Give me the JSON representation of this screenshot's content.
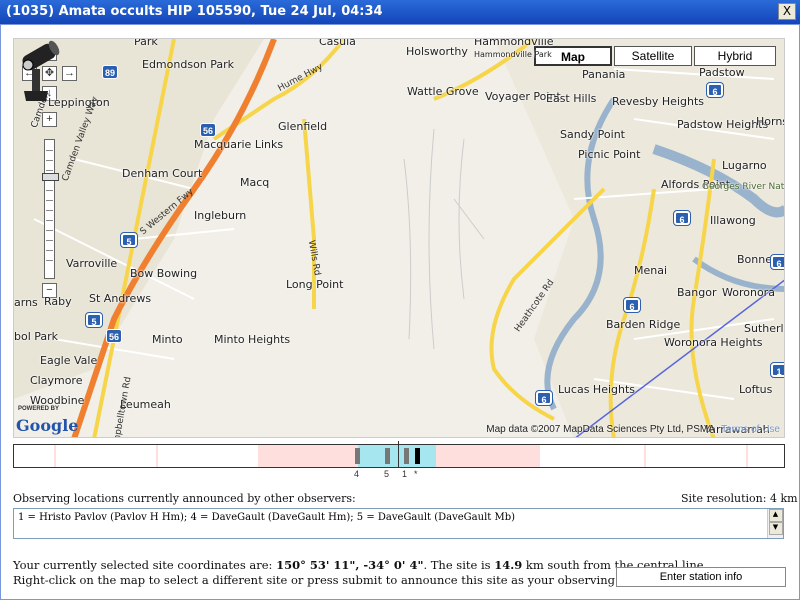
{
  "window": {
    "title": "(1035) Amata occults HIP 105590, Tue 24 Jul, 04:34",
    "close_glyph": "X"
  },
  "map": {
    "types": [
      {
        "label": "Map",
        "active": true
      },
      {
        "label": "Satellite",
        "active": false
      },
      {
        "label": "Hybrid",
        "active": false
      }
    ],
    "zoom_in": "+",
    "zoom_out": "−",
    "places": [
      "Park",
      "Casula",
      "Holsworthy",
      "Hammondville",
      "Hammondville Park",
      "Padstow",
      "Panania",
      "Edmondson Park",
      "Wattle Grove",
      "Voyager Point",
      "East Hills",
      "Revesby Heights",
      "Padstow Heights",
      "Hornsby Heights",
      "Leppington",
      "Glenfield",
      "Sandy Point",
      "Picnic Point",
      "Lugarno",
      "Macquarie Links",
      "Denham Court",
      "Alfords Point",
      "Georges River National Park",
      "Illawong",
      "Ingleburn",
      "Macq",
      "Bonnet Bay",
      "Varroville",
      "Bow Bowing",
      "Long Point",
      "Menai",
      "Bangor",
      "Woronora",
      "Raby",
      "St Andrews",
      "Sutherland",
      "Barden Ridge",
      "Minto",
      "Minto Heights",
      "Woronora Heights",
      "Eagle Vale",
      "Claymore",
      "Lucas Heights",
      "Loftus",
      "Woodbine",
      "Leumeah",
      "Yarrawarrah",
      "arns",
      "bol Park",
      "Camden"
    ],
    "roads": [
      "Hume Hwy",
      "S Western Fwy",
      "Wills Rd",
      "Heathcote Rd",
      "Campbelltown Rd",
      "Camden Valley Way"
    ],
    "shields": [
      "89",
      "56",
      "5",
      "56",
      "5",
      "6",
      "6",
      "6",
      "6",
      "6",
      "1"
    ],
    "copyright": "Map data ©2007 MapData Sciences Pty Ltd, PSMA",
    "terms": "Terms of Use",
    "logo": "Google",
    "logo_powered": "POWERED BY",
    "marker": "telescope-observer"
  },
  "timeline": {
    "labels": [
      "4",
      "5",
      "1",
      "*"
    ],
    "colors": {
      "outer": "#ffdede",
      "central": "#a6e6ee",
      "station": "#777777",
      "selected": "#000000"
    }
  },
  "observers": {
    "heading": "Observing locations currently announced by other observers:",
    "resolution": "Site resolution: 4 km",
    "list": "1 = Hristo Pavlov (Pavlov H Hm); 4 = DaveGault (DaveGault Hm); 5 = DaveGault (DaveGault Mb)"
  },
  "selection": {
    "prefix": "Your currently selected site coordinates are: ",
    "coords": "150° 53' 11\", -34° 0' 4\"",
    "mid": ". The site is ",
    "distance": "14.9",
    "suffix": " km south from the central line.",
    "instruction": "Right-click on the map to select a different site or press submit to announce this site as your observing location."
  },
  "submit_label": "Enter station info"
}
